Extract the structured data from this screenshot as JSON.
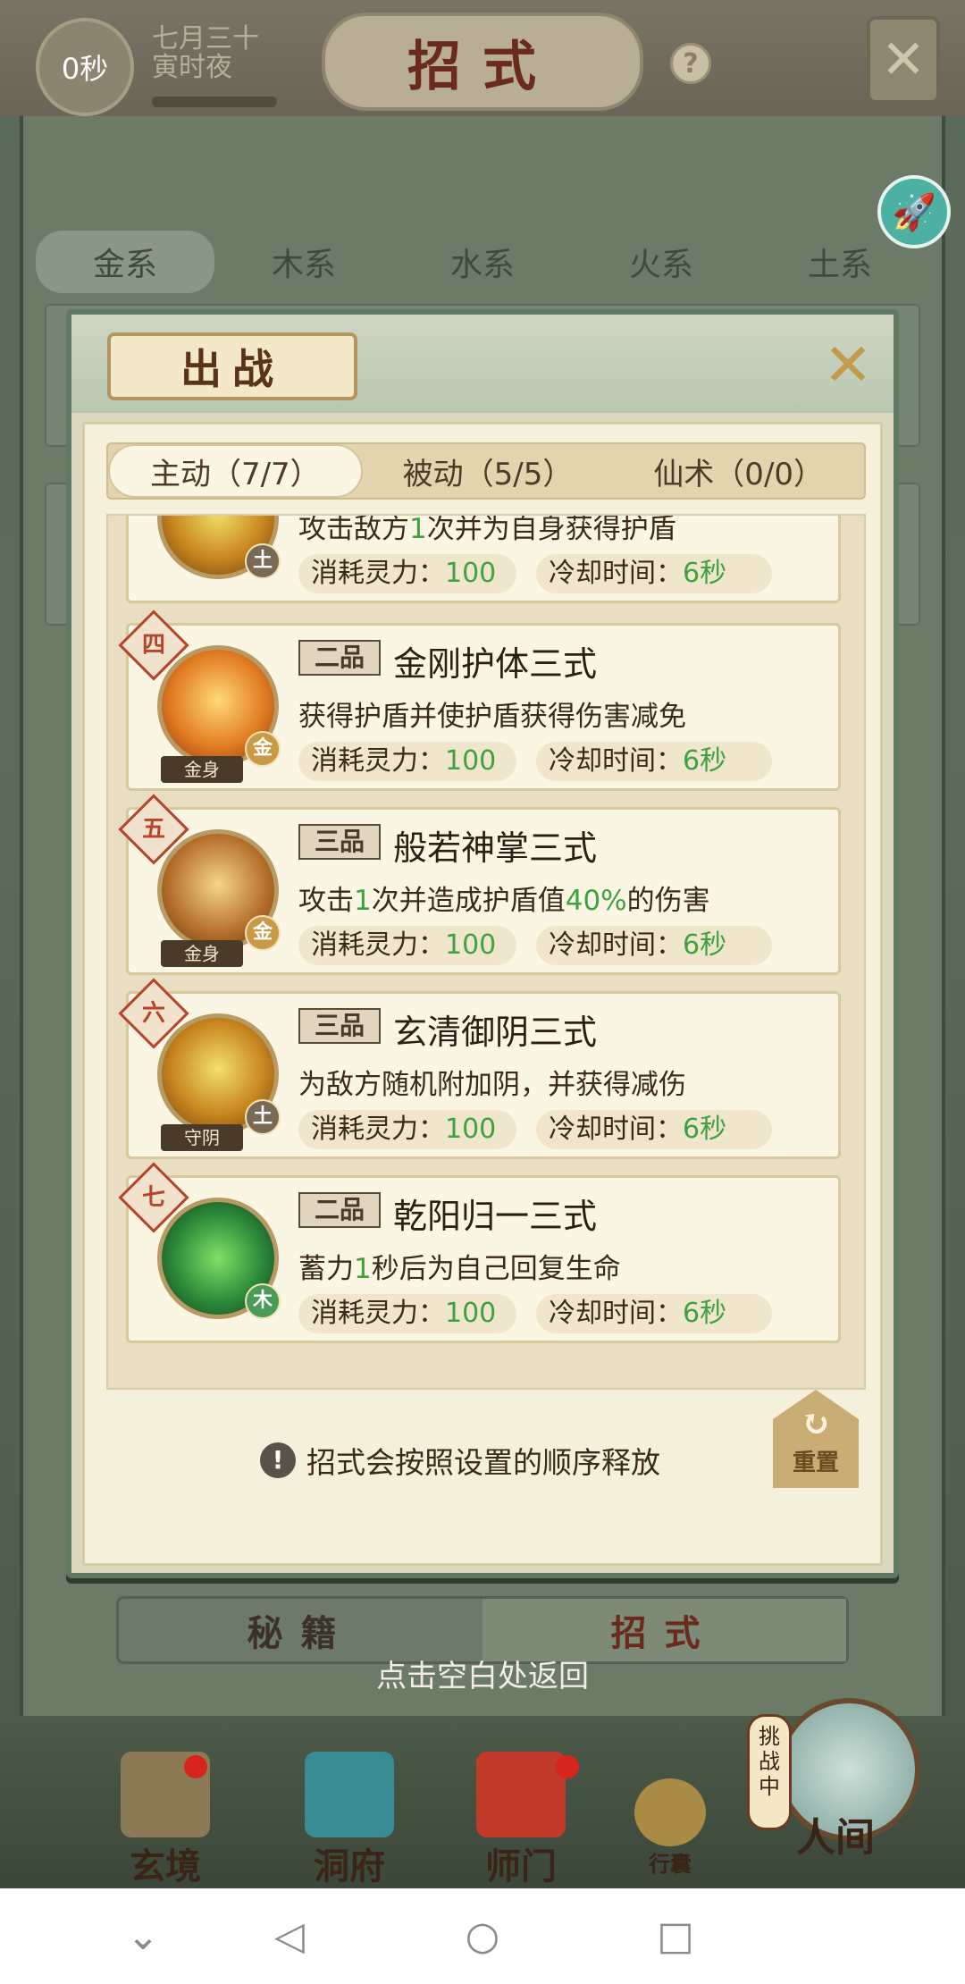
{
  "top": {
    "timer": "0秒",
    "date_line1": "七月三十",
    "date_line2": "寅时夜",
    "title": "招式",
    "help": "?"
  },
  "element_tabs": [
    "金系",
    "木系",
    "水系",
    "火系",
    "土系"
  ],
  "dialog": {
    "title": "出战",
    "sub_tabs": [
      "主动（7/7）",
      "被动（5/5）",
      "仙术（0/0）"
    ],
    "skills": [
      {
        "number": "",
        "grade": "",
        "name": "",
        "element": "土",
        "tag": "",
        "desc": [
          "攻击敌方",
          "1",
          "次并为自身获得护盾"
        ],
        "cost_label": "消耗灵力：",
        "cost_value": "100",
        "cd_label": "冷却时间：",
        "cd_value": "6秒"
      },
      {
        "number": "四",
        "grade": "二品",
        "name": "金刚护体三式",
        "element": "金",
        "tag": "金身",
        "desc": [
          "获得护盾并使护盾获得伤害减免",
          "",
          ""
        ],
        "cost_label": "消耗灵力：",
        "cost_value": "100",
        "cd_label": "冷却时间：",
        "cd_value": "6秒"
      },
      {
        "number": "五",
        "grade": "三品",
        "name": "般若神掌三式",
        "element": "金",
        "tag": "金身",
        "desc": [
          "攻击",
          "1",
          "次并造成护盾值",
          "40%",
          "的伤害"
        ],
        "cost_label": "消耗灵力：",
        "cost_value": "100",
        "cd_label": "冷却时间：",
        "cd_value": "6秒"
      },
      {
        "number": "六",
        "grade": "三品",
        "name": "玄清御阴三式",
        "element": "土",
        "tag": "守阴",
        "desc": [
          "为敌方随机附加阴，并获得减伤",
          "",
          ""
        ],
        "cost_label": "消耗灵力：",
        "cost_value": "100",
        "cd_label": "冷却时间：",
        "cd_value": "6秒"
      },
      {
        "number": "七",
        "grade": "二品",
        "name": "乾阳归一三式",
        "element": "木",
        "tag": "",
        "desc": [
          "蓄力",
          "1",
          "秒后为自己回复生命"
        ],
        "cost_label": "消耗灵力：",
        "cost_value": "100",
        "cd_label": "冷却时间：",
        "cd_value": "6秒"
      }
    ],
    "order_note": "招式会按照设置的顺序释放",
    "reset_label": "重置"
  },
  "bottom_tabs": [
    "秘籍",
    "招式"
  ],
  "tap_back": "点击空白处返回",
  "game_nav": {
    "items": [
      "玄境",
      "洞府",
      "师门",
      "行囊",
      "人间"
    ],
    "challenge": "挑战中"
  }
}
